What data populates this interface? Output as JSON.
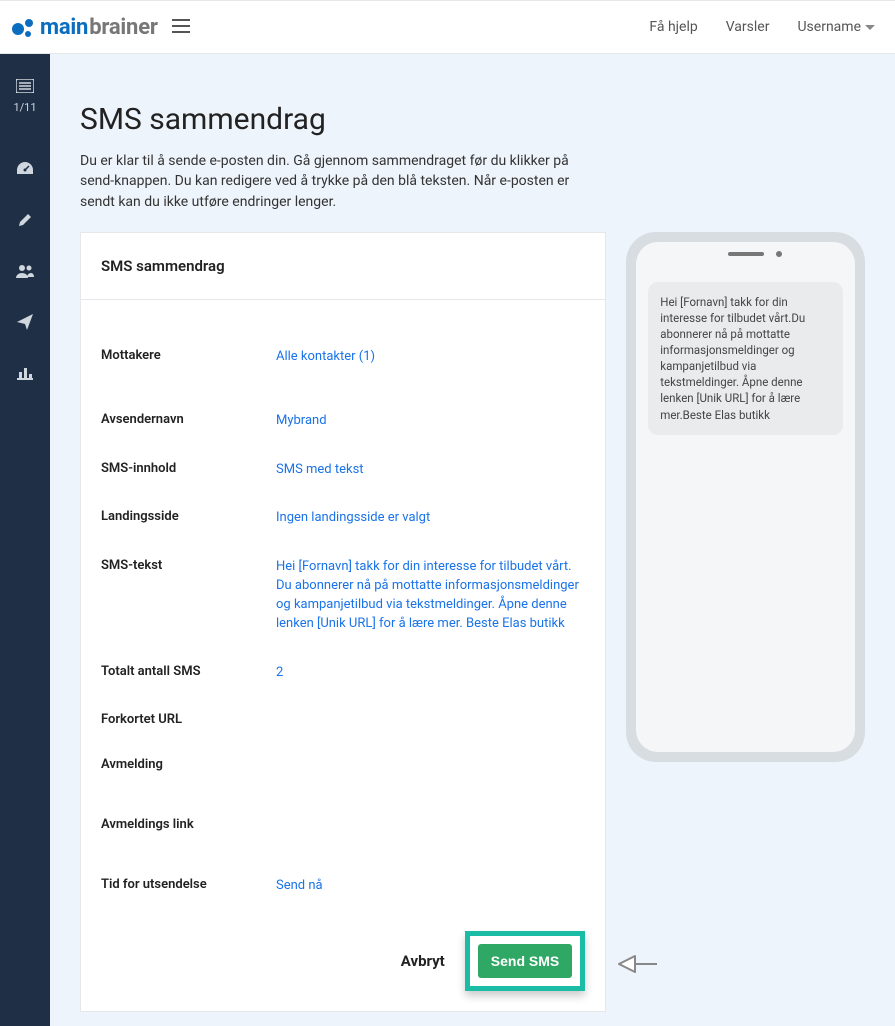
{
  "header": {
    "logo_main": "main",
    "logo_sub": "brainer",
    "help": "Få hjelp",
    "alerts": "Varsler",
    "username": "Username"
  },
  "sidebar": {
    "step_counter": "1/11"
  },
  "page": {
    "title": "SMS sammendrag",
    "subtitle": "Du er klar til å sende e-posten din. Gå gjennom sammendraget før du klikker på send-knappen. Du kan redigere ved å trykke på den blå teksten. Når e-posten er sendt kan du ikke utføre endringer lenger."
  },
  "card": {
    "title": "SMS sammendrag",
    "rows": {
      "recipients": {
        "label": "Mottakere",
        "value": "Alle kontakter (1)"
      },
      "sender": {
        "label": "Avsendernavn",
        "value": "Mybrand"
      },
      "content": {
        "label": "SMS-innhold",
        "value": "SMS med tekst"
      },
      "landing": {
        "label": "Landingsside",
        "value": "Ingen landingsside er valgt"
      },
      "text": {
        "label": "SMS-tekst",
        "value": "Hei [Fornavn] takk for din interesse for tilbudet vårt. Du abonnerer nå på mottatte informasjonsmeldinger og kampanjetilbud via tekstmeldinger. Åpne denne lenken [Unik URL] for å lære mer. Beste Elas butikk"
      },
      "total": {
        "label": "Totalt antall SMS",
        "value": "2"
      },
      "short": {
        "label": "Forkortet URL",
        "value": ""
      },
      "unsub": {
        "label": "Avmelding",
        "value": ""
      },
      "unsublink": {
        "label": "Avmeldings link",
        "value": ""
      },
      "sendtime": {
        "label": "Tid for utsendelse",
        "value": "Send nå"
      }
    },
    "cancel": "Avbryt",
    "send": "Send SMS"
  },
  "phone": {
    "message": "Hei [Fornavn] takk for din interesse for tilbudet vårt.Du abonnerer nå på mottatte informasjonsmeldinger og kampanjetilbud via tekstmeldinger. Åpne denne lenken [Unik URL] for å lære mer.Beste Elas butikk"
  }
}
